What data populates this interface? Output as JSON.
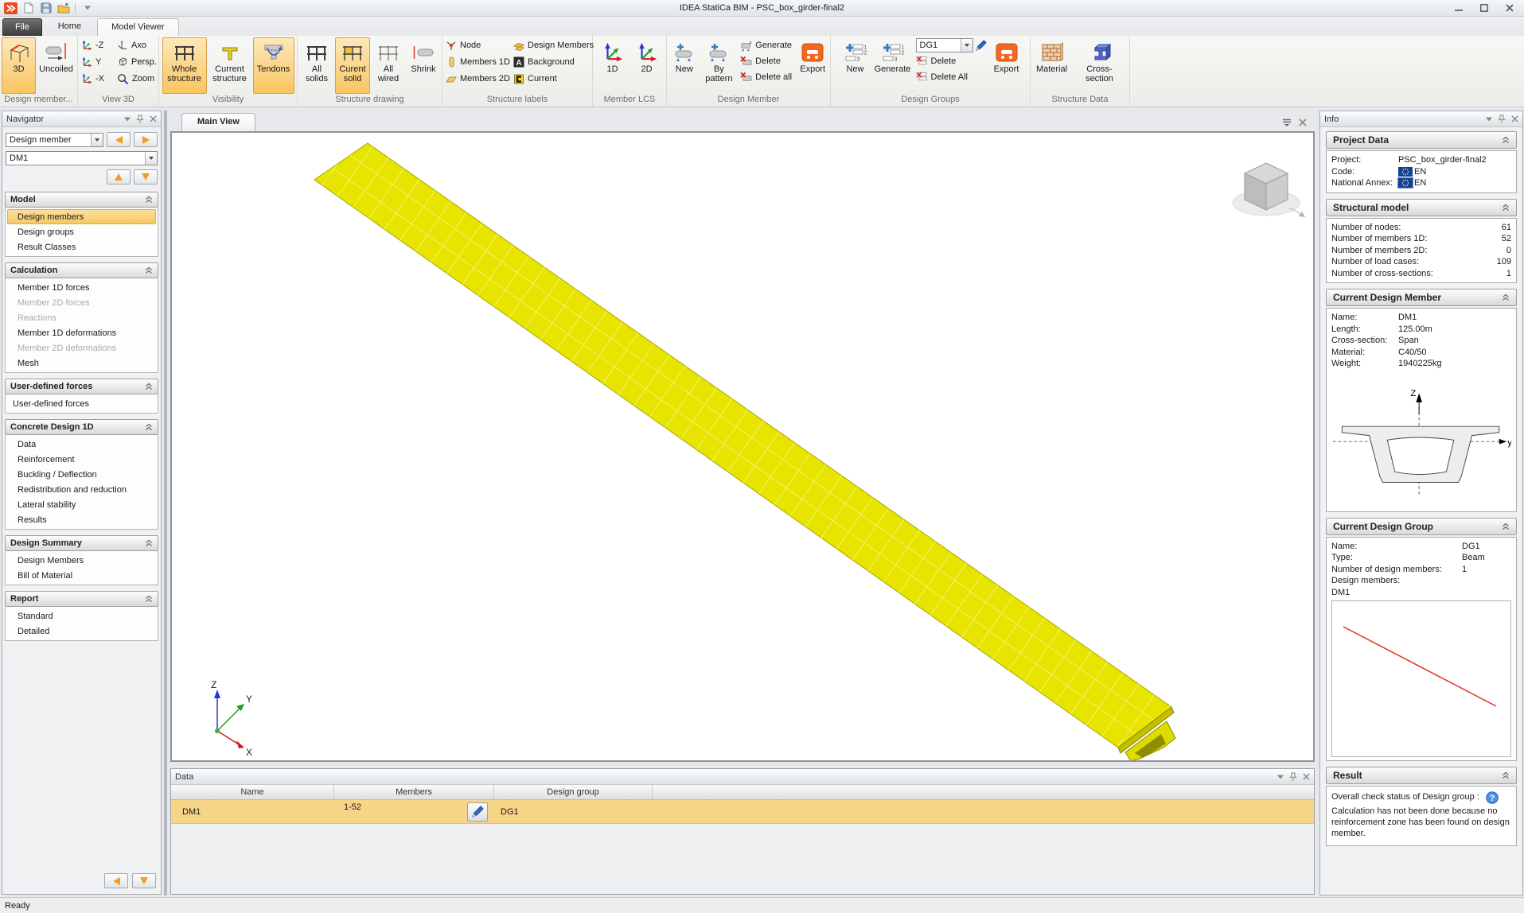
{
  "window": {
    "title": "IDEA StatiCa BIM - PSC_box_girder-final2",
    "status": "Ready"
  },
  "tabs": {
    "file": "File",
    "home": "Home",
    "model_viewer": "Model Viewer"
  },
  "ribbon": {
    "design_member_view": {
      "label": "Design member...",
      "btn_3d": "3D",
      "btn_uncoiled": "Uncoiled"
    },
    "view3d": {
      "label": "View 3D",
      "minus_z": "-Z",
      "y": "Y",
      "minus_x": "-X",
      "axo": "Axo",
      "persp": "Persp.",
      "zoom": "Zoom"
    },
    "visibility": {
      "label": "Visibility",
      "whole_structure": "Whole structure",
      "current_structure": "Current structure",
      "tendons": "Tendons"
    },
    "structure_drawing": {
      "label": "Structure drawing",
      "all_solids": "All solids",
      "current_solid": "Curent solid",
      "all_wired": "All wired",
      "shrink": "Shrink"
    },
    "structure_labels": {
      "label": "Structure labels",
      "node": "Node",
      "members_1d": "Members 1D",
      "members_2d": "Members 2D",
      "design_members": "Design Members",
      "background": "Background",
      "background_icon_letter": "A",
      "current": "Current"
    },
    "member_lcs": {
      "label": "Member LCS",
      "btn_1d": "1D",
      "btn_2d": "2D"
    },
    "design_member": {
      "label": "Design Member",
      "new": "New",
      "by_pattern": "By pattern",
      "generate": "Generate",
      "delete": "Delete",
      "delete_all": "Delete all",
      "export": "Export"
    },
    "design_groups": {
      "label": "Design Groups",
      "new": "New",
      "generate": "Generate",
      "combo_value": "DG1",
      "delete": "Delete",
      "delete_all": "Delete All",
      "export": "Export",
      "icon_digit_1": "1",
      "icon_digit_2": "2",
      "icon_digit_3": "3"
    },
    "structure_data": {
      "label": "Structure Data",
      "material": "Material",
      "cross_section": "Cross-section"
    }
  },
  "navigator": {
    "title": "Navigator",
    "mode_combo_value": "Design member",
    "member_combo_value": "DM1",
    "sections": [
      {
        "title": "Model",
        "items": [
          {
            "label": "Design members",
            "state": "selected"
          },
          {
            "label": "Design groups",
            "state": "normal"
          },
          {
            "label": "Result Classes",
            "state": "normal"
          }
        ]
      },
      {
        "title": "Calculation",
        "items": [
          {
            "label": "Member 1D forces",
            "state": "normal"
          },
          {
            "label": "Member 2D forces",
            "state": "disabled"
          },
          {
            "label": "Reactions",
            "state": "disabled"
          },
          {
            "label": "Member 1D deformations",
            "state": "normal"
          },
          {
            "label": "Member 2D deformations",
            "state": "disabled"
          },
          {
            "label": "Mesh",
            "state": "normal"
          }
        ]
      },
      {
        "title": "User-defined forces",
        "items": [
          {
            "label": "User-defined forces",
            "state": "normal"
          }
        ]
      },
      {
        "title": "Concrete Design 1D",
        "items": [
          {
            "label": "Data",
            "state": "normal"
          },
          {
            "label": "Reinforcement",
            "state": "normal"
          },
          {
            "label": "Buckling / Deflection",
            "state": "normal"
          },
          {
            "label": "Redistribution and reduction",
            "state": "normal"
          },
          {
            "label": "Lateral stability",
            "state": "normal"
          },
          {
            "label": "Results",
            "state": "normal"
          }
        ]
      },
      {
        "title": "Design Summary",
        "items": [
          {
            "label": "Design Members",
            "state": "normal"
          },
          {
            "label": "Bill of Material",
            "state": "normal"
          }
        ]
      },
      {
        "title": "Report",
        "items": [
          {
            "label": "Standard",
            "state": "normal"
          },
          {
            "label": "Detailed",
            "state": "normal"
          }
        ]
      }
    ]
  },
  "main_view": {
    "tab": "Main View"
  },
  "viewport": {
    "axis_x": "X",
    "axis_y": "Y",
    "axis_z": "Z"
  },
  "data_panel": {
    "title": "Data",
    "columns": {
      "name": "Name",
      "members": "Members",
      "design_group": "Design group"
    },
    "row": {
      "name": "DM1",
      "members": "1-52",
      "design_group": "DG1"
    }
  },
  "info_panel": {
    "title": "Info",
    "project_data": {
      "title": "Project Data",
      "project_label": "Project:",
      "project_value": "PSC_box_girder-final2",
      "code_label": "Code:",
      "code_value": "EN",
      "annex_label": "National Annex:",
      "annex_value": "EN"
    },
    "structural_model": {
      "title": "Structural model",
      "rows": [
        {
          "label": "Number of nodes:",
          "value": "61"
        },
        {
          "label": "Number of members 1D:",
          "value": "52"
        },
        {
          "label": "Number of members 2D:",
          "value": "0"
        },
        {
          "label": "Number of load cases:",
          "value": "109"
        },
        {
          "label": "Number of cross-sections:",
          "value": "1"
        }
      ]
    },
    "current_design_member": {
      "title": "Current Design Member",
      "rows": [
        {
          "label": "Name:",
          "value": "DM1"
        },
        {
          "label": "Length:",
          "value": "125.00m"
        },
        {
          "label": "Cross-section:",
          "value": "Span"
        },
        {
          "label": "Material:",
          "value": "C40/50"
        },
        {
          "label": "Weight:",
          "value": "1940225kg"
        }
      ],
      "section_axis_z": "Z",
      "section_axis_y": "y"
    },
    "current_design_group": {
      "title": "Current Design Group",
      "rows": [
        {
          "label": "Name:",
          "value": "DG1"
        },
        {
          "label": "Type:",
          "value": "Beam"
        },
        {
          "label": "Number of design members:",
          "value": "1"
        },
        {
          "label": "Design members:",
          "value": ""
        }
      ],
      "member_list": "DM1"
    },
    "result": {
      "title": "Result",
      "line1": "Overall check status of Design group :",
      "help_glyph": "?",
      "line2": "Calculation has not been done because no reinforcement zone has been found on design member."
    }
  },
  "colors": {
    "selection_orange": "#F8CF6F",
    "active_button_orange": "#F9C660",
    "export_orange": "#F26822",
    "girder_yellow": "#E7E400",
    "row_highlight": "#F6D589",
    "axis_blue": "#2238CC",
    "axis_green": "#1FA01F",
    "axis_red": "#CC2020",
    "result_line_red": "#E83020",
    "eu_flag_blue": "#1040A0",
    "eu_star_yellow": "#FFD020"
  }
}
